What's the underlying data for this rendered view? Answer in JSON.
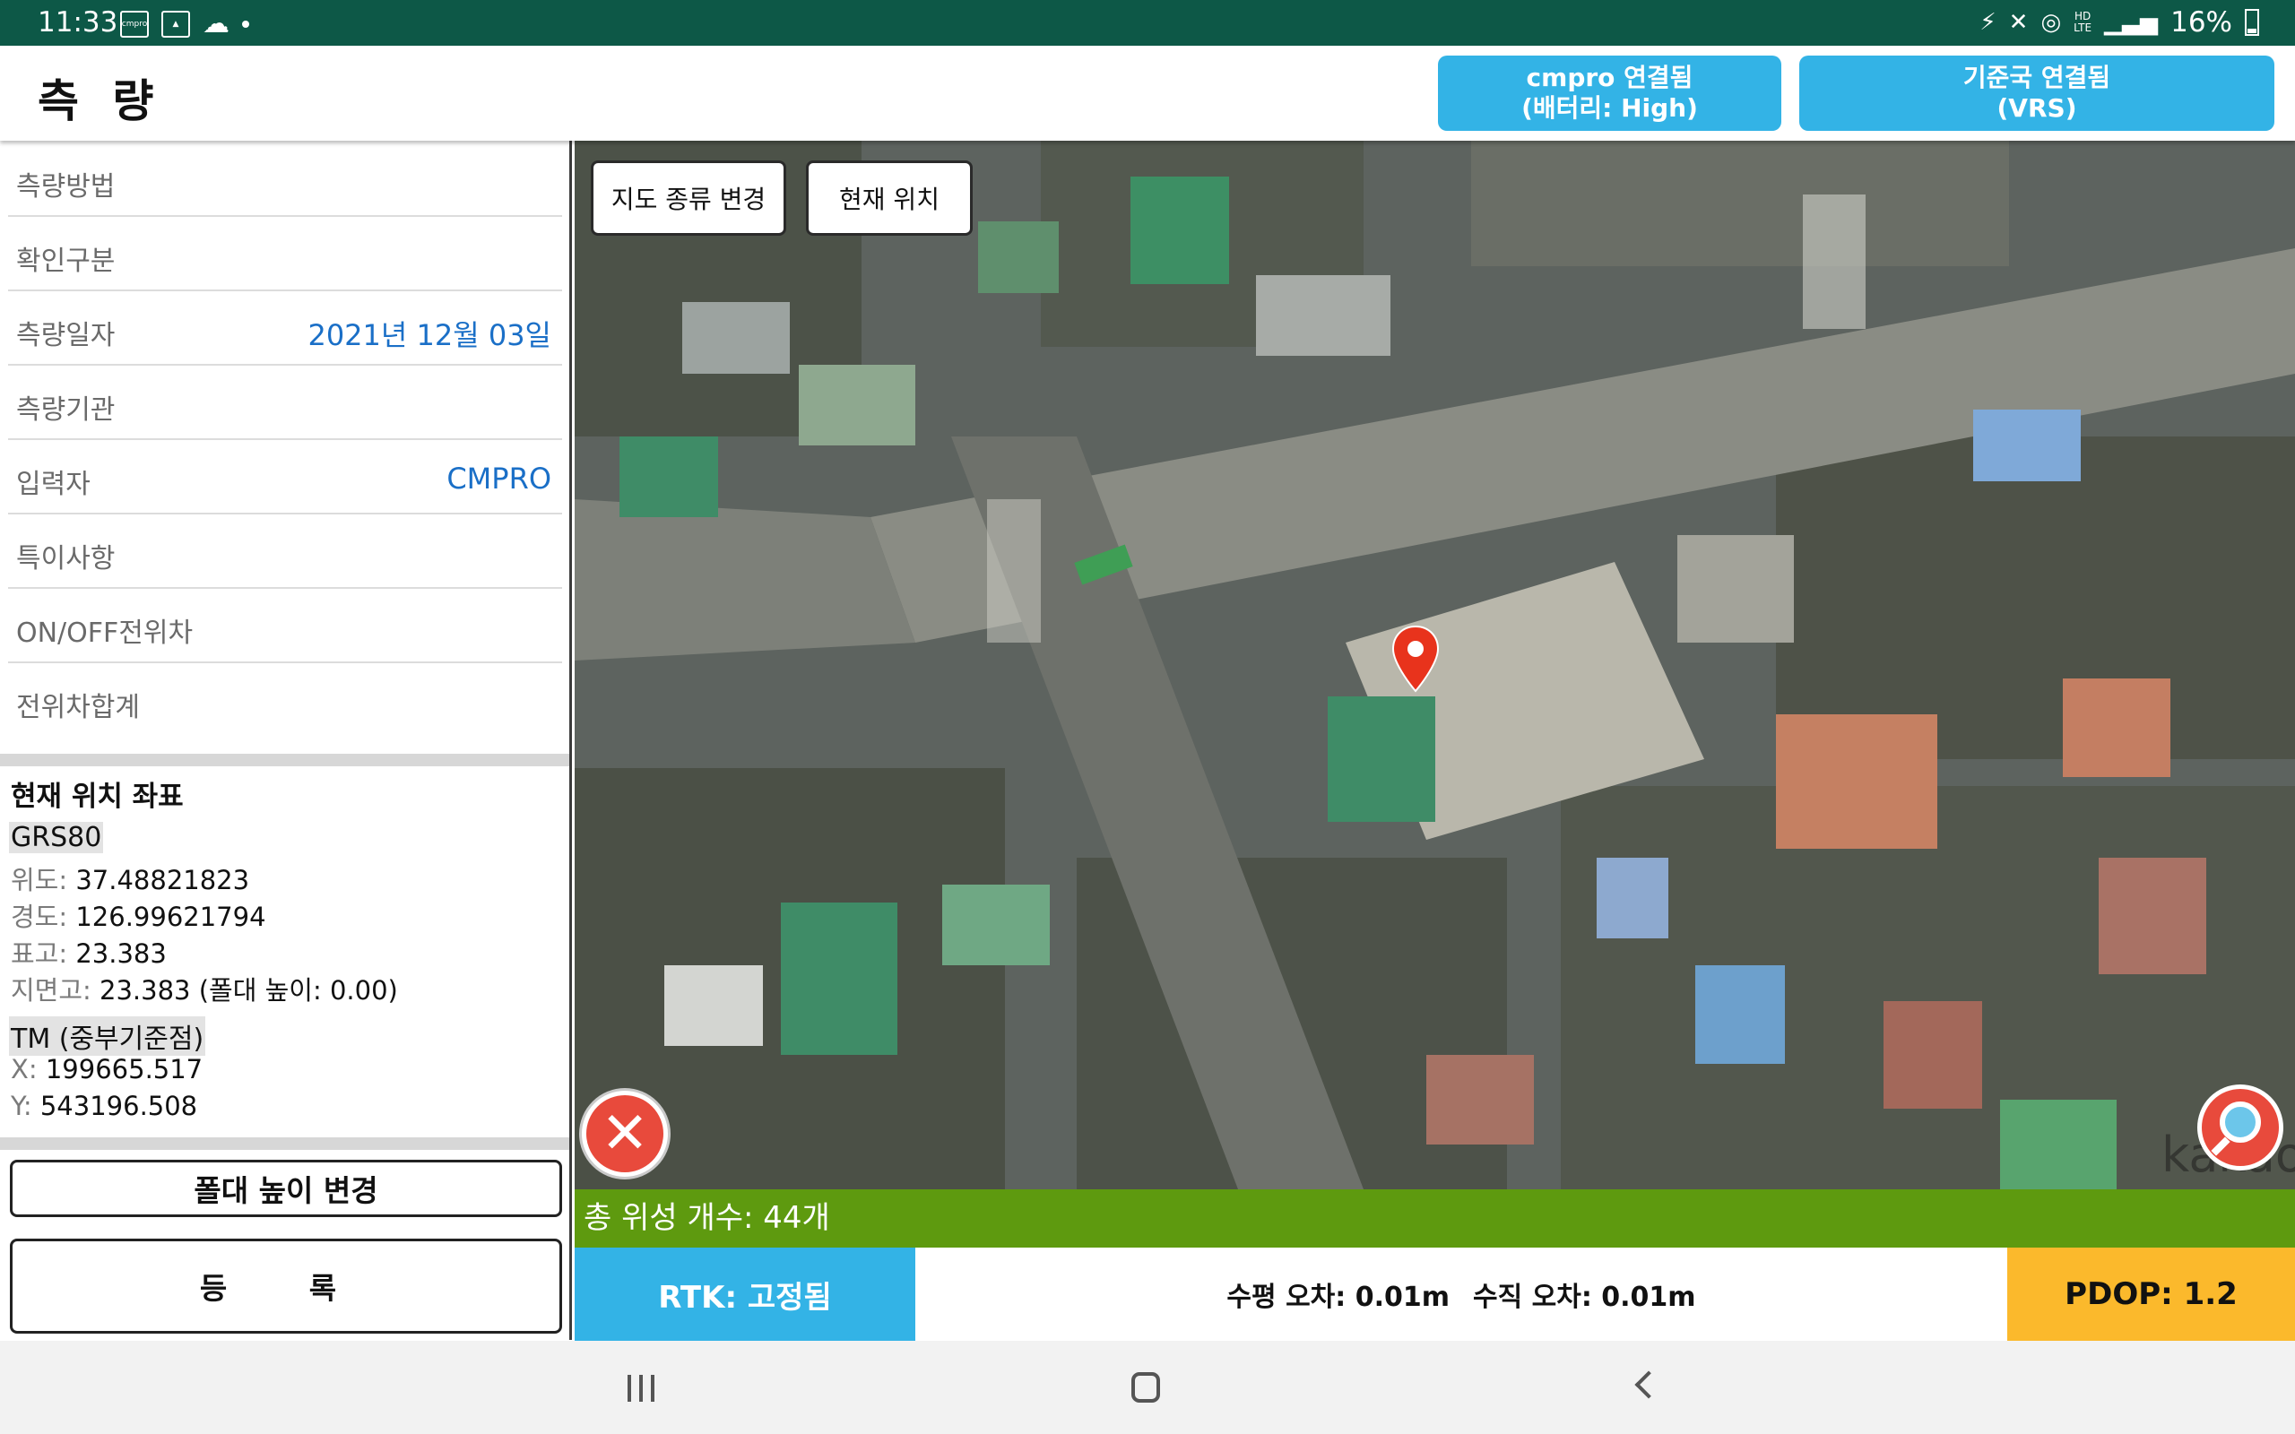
{
  "status_bar": {
    "time": "11:33",
    "app_icon_text": "cmpro",
    "right_icons": [
      "signal-off-icon",
      "mute-icon",
      "hotspot-icon",
      "hd-lte-icon",
      "signal-bars-icon"
    ],
    "hd_label": "HD",
    "lte_label": "LTE",
    "battery": "16%"
  },
  "header": {
    "title": "측 량",
    "device_button": {
      "line1": "cmpro 연결됨",
      "line2": "(배터리: High)"
    },
    "base_button": {
      "line1": "기준국 연결됨",
      "line2": "(VRS)"
    }
  },
  "form_rows": [
    {
      "label": "측량방법",
      "value": ""
    },
    {
      "label": "확인구분",
      "value": ""
    },
    {
      "label": "측량일자",
      "value": "2021년 12월 03일"
    },
    {
      "label": "측량기관",
      "value": ""
    },
    {
      "label": "입력자",
      "value": "CMPRO"
    },
    {
      "label": "특이사항",
      "value": ""
    },
    {
      "label": "ON/OFF전위차",
      "value": ""
    },
    {
      "label": "전위차합계",
      "value": ""
    }
  ],
  "coords": {
    "heading": "현재 위치 좌표",
    "grs80_tag": "GRS80",
    "lat_label": "위도:",
    "lat": "37.48821823",
    "lon_label": "경도:",
    "lon": "126.99621794",
    "elev_label": "표고:",
    "elev": "23.383",
    "ground_label": "지면고:",
    "ground": "23.383 (폴대 높이: 0.00)",
    "tm_tag": "TM (중부기준점)",
    "x_label": "X:",
    "x": "199665.517",
    "y_label": "Y:",
    "y": "543196.508"
  },
  "buttons": {
    "pole_height": "폴대 높이 변경",
    "register": "등 록"
  },
  "map": {
    "map_type_button": "지도 종류 변경",
    "current_location_button": "현재 위치",
    "watermark": "kakao",
    "marker_color": "#e8331c"
  },
  "gnss": {
    "satellites": "총 위성 개수: 44개",
    "rtk": "RTK: 고정됨",
    "horizontal_error": "수평 오차: 0.01m",
    "vertical_error": "수직 오차: 0.01m",
    "pdop": "PDOP: 1.2"
  },
  "colors": {
    "status_bar": "#0d5847",
    "accent_blue": "#33b3e6",
    "satellite_bar": "#5e9a0f",
    "pdop": "#fbb92c",
    "value_text": "#1a6fc7"
  }
}
